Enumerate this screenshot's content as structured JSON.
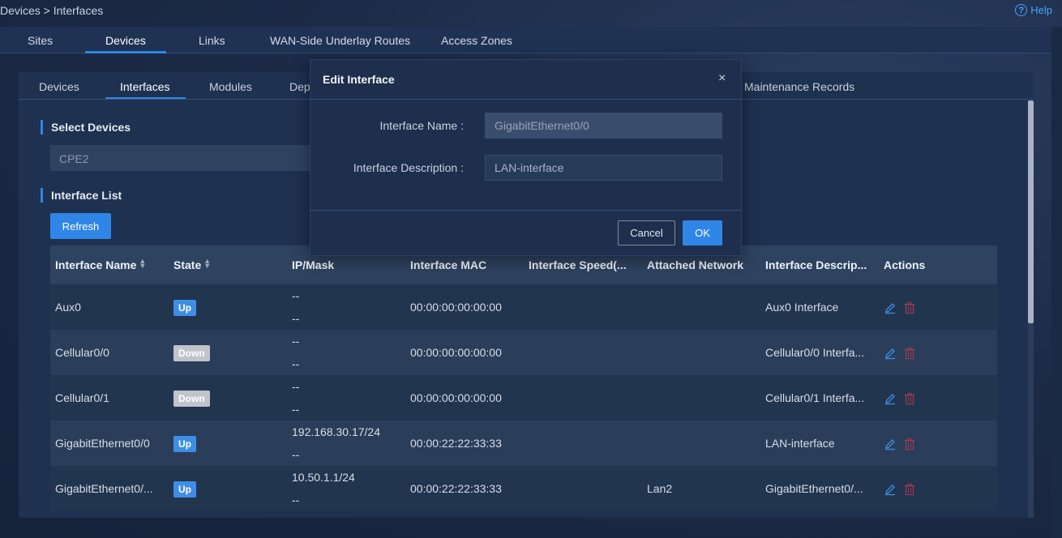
{
  "breadcrumb": "Devices > Interfaces",
  "help_label": "Help",
  "top_tabs": [
    "Sites",
    "Devices",
    "Links",
    "WAN-Side Underlay Routes",
    "Access Zones"
  ],
  "sub_tabs": [
    "Devices",
    "Interfaces",
    "Modules",
    "Dep",
    "Maintenance Records"
  ],
  "select_devices": {
    "title": "Select Devices",
    "value": "CPE2"
  },
  "interface_list": {
    "title": "Interface List",
    "refresh_label": "Refresh"
  },
  "table": {
    "headers": [
      "Interface Name",
      "State",
      "IP/Mask",
      "Interface MAC",
      "Interface Speed(...",
      "Attached Network",
      "Interface Descrip...",
      "Actions"
    ],
    "rows": [
      {
        "name": "Aux0",
        "state": "Up",
        "ip1": "--",
        "ip2": "--",
        "mac": "00:00:00:00:00:00",
        "speed": "",
        "network": "",
        "desc": "Aux0 Interface"
      },
      {
        "name": "Cellular0/0",
        "state": "Down",
        "ip1": "--",
        "ip2": "--",
        "mac": "00:00:00:00:00:00",
        "speed": "",
        "network": "",
        "desc": "Cellular0/0 Interfa..."
      },
      {
        "name": "Cellular0/1",
        "state": "Down",
        "ip1": "--",
        "ip2": "--",
        "mac": "00:00:00:00:00:00",
        "speed": "",
        "network": "",
        "desc": "Cellular0/1 Interfa..."
      },
      {
        "name": "GigabitEthernet0/0",
        "state": "Up",
        "ip1": "192.168.30.17/24",
        "ip2": "--",
        "mac": "00:00:22:22:33:33",
        "speed": "",
        "network": "",
        "desc": "LAN-interface"
      },
      {
        "name": "GigabitEthernet0/...",
        "state": "Up",
        "ip1": "10.50.1.1/24",
        "ip2": "--",
        "mac": "00:00:22:22:33:33",
        "speed": "",
        "network": "Lan2",
        "desc": "GigabitEthernet0/..."
      }
    ]
  },
  "dialog": {
    "title": "Edit Interface",
    "close_glyph": "×",
    "name_label": "Interface Name :",
    "name_value": "GigabitEthernet0/0",
    "desc_label": "Interface Description :",
    "desc_value": "LAN-interface",
    "cancel_label": "Cancel",
    "ok_label": "OK"
  },
  "colors": {
    "accent": "#2f86e6",
    "up_badge": "#3f8ee6",
    "down_badge": "#c0c4cb",
    "delete_icon": "#a53a4a"
  }
}
